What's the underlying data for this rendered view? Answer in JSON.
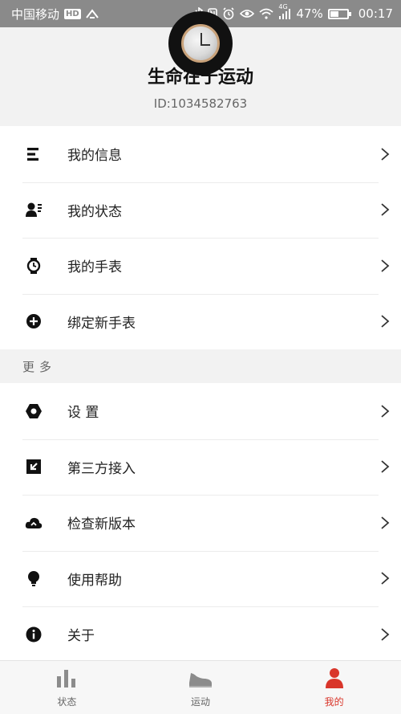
{
  "status_bar": {
    "carrier": "中国移动",
    "hd": "HD",
    "network": "4G",
    "battery": "47%",
    "battery_level": 0.47,
    "time": "00:17"
  },
  "profile": {
    "name": "生命在于运动",
    "id": "ID:1034582763"
  },
  "menu_top": [
    {
      "label": "我的信息",
      "icon": "list-icon"
    },
    {
      "label": "我的状态",
      "icon": "user-status-icon"
    },
    {
      "label": "我的手表",
      "icon": "watch-icon"
    },
    {
      "label": "绑定新手表",
      "icon": "plus-circle-icon"
    }
  ],
  "section_more": "更多",
  "menu_more": [
    {
      "label": "设 置",
      "icon": "settings-hex-icon"
    },
    {
      "label": "第三方接入",
      "icon": "third-party-icon"
    },
    {
      "label": "检查新版本",
      "icon": "cloud-icon"
    },
    {
      "label": "使用帮助",
      "icon": "bulb-icon"
    },
    {
      "label": "关于",
      "icon": "info-icon"
    }
  ],
  "tabs": [
    {
      "label": "状态",
      "icon": "bar-chart-icon",
      "active": false
    },
    {
      "label": "运动",
      "icon": "shoe-icon",
      "active": false
    },
    {
      "label": "我的",
      "icon": "person-icon",
      "active": true
    }
  ],
  "colors": {
    "accent": "#d9362b",
    "header_bg": "#f2f2f2",
    "status_bar_bg": "#8a8a8a"
  }
}
